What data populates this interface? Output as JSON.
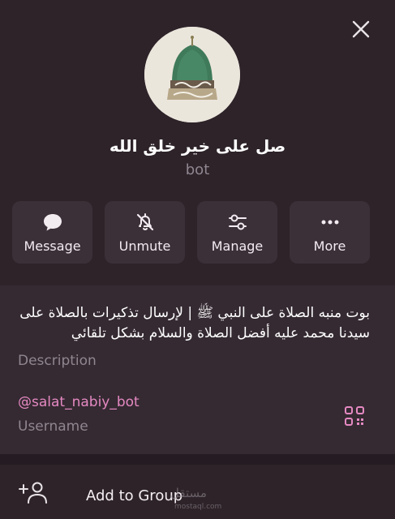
{
  "header": {
    "bot_name": "صل على خير خلق الله",
    "bot_type": "bot"
  },
  "actions": [
    {
      "label": "Message",
      "icon": "chat-bubble-icon"
    },
    {
      "label": "Unmute",
      "icon": "bell-off-icon"
    },
    {
      "label": "Manage",
      "icon": "sliders-icon"
    },
    {
      "label": "More",
      "icon": "more-dots-icon"
    }
  ],
  "info": {
    "description": "بوت منبه الصلاة على النبي ﷺ  |  لإرسال تذكيرات بالصلاة على سيدنا محمد عليه أفضل الصلاة والسلام بشكل تلقائي",
    "description_label": "Description",
    "username": "@salat_nabiy_bot",
    "username_label": "Username"
  },
  "group_row": {
    "label": "Add to Group"
  },
  "watermark": {
    "text": "مستقل",
    "subtext": "mostaql.com"
  },
  "colors": {
    "background": "#2a2128",
    "panel": "#352a32",
    "button": "#3b3038",
    "accent": "#e589c2",
    "muted_text": "#8f8690"
  }
}
